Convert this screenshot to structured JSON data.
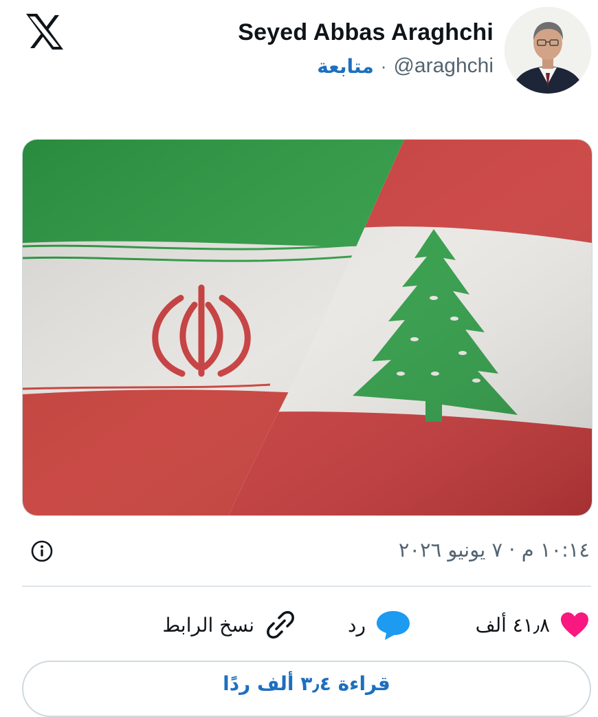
{
  "header": {
    "display_name": "Seyed Abbas Araghchi",
    "handle": "@araghchi",
    "separator": "·",
    "follow_label": "متابعة"
  },
  "icons": {
    "logo": "x-logo-icon",
    "info": "info-circle-icon",
    "like": "heart-icon",
    "reply": "speech-bubble-icon",
    "copy_link": "link-icon"
  },
  "tweet": {
    "timestamp": "١٠:١٤ م · ٧ يونيو ٢٠٢٦"
  },
  "actions": {
    "like_count": "٤١٫٨ ألف",
    "reply_label": "رد",
    "copy_link_label": "نسخ الرابط"
  },
  "footer": {
    "read_replies_label": "قراءة ٣٫٤ ألف ردًا"
  },
  "colors": {
    "accent": "#1d6fbf",
    "like": "#f91880",
    "reply": "#1d9bf0",
    "text_secondary": "#536471"
  }
}
